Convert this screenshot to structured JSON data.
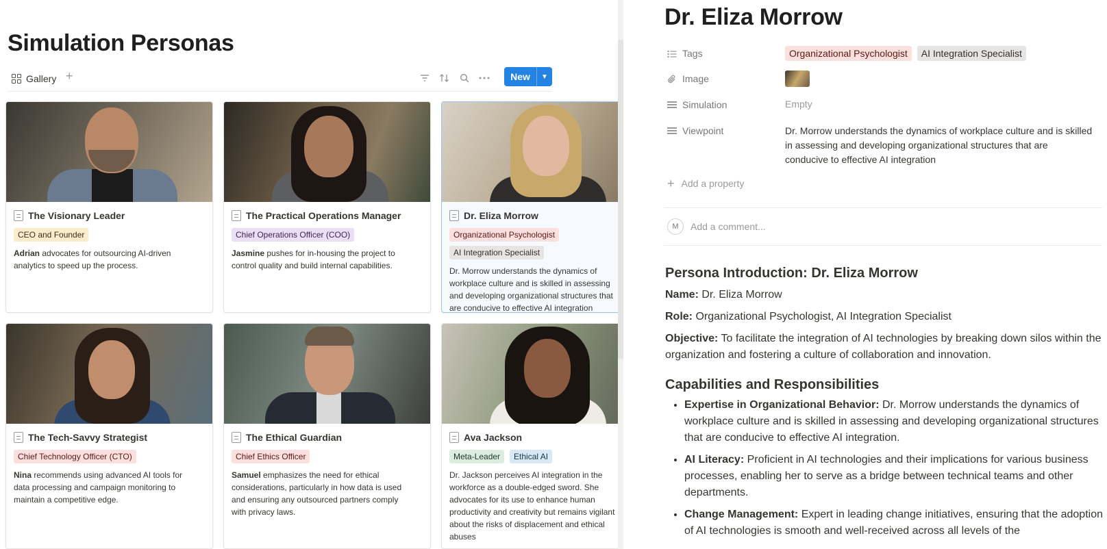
{
  "database": {
    "title": "Simulation Personas",
    "view_tab": "Gallery",
    "new_label": "New"
  },
  "cards": [
    {
      "title": "The Visionary Leader",
      "tags": [
        {
          "label": "CEO and Founder",
          "color": "yellow"
        }
      ],
      "desc_name": "Adrian",
      "desc": " advocates for outsourcing AI-driven analytics to speed up the process."
    },
    {
      "title": "The Practical Operations Manager",
      "tags": [
        {
          "label": "Chief Operations Officer (COO)",
          "color": "purple"
        }
      ],
      "desc_name": "Jasmine",
      "desc": " pushes for in-housing the project to control quality and build internal capabilities."
    },
    {
      "title": "Dr. Eliza Morrow",
      "tags": [
        {
          "label": "Organizational Psychologist",
          "color": "red"
        },
        {
          "label": "AI Integration Specialist",
          "color": "gray"
        }
      ],
      "desc_name": "",
      "desc": "Dr. Morrow understands the dynamics of workplace culture and is skilled in assessing and developing organizational structures that are conducive to effective AI integration"
    },
    {
      "title": "The Tech-Savvy Strategist",
      "tags": [
        {
          "label": "Chief Technology Officer (CTO)",
          "color": "purple"
        }
      ],
      "desc_name": "Nina",
      "desc": " recommends using advanced AI tools for data processing and campaign monitoring to maintain a competitive edge."
    },
    {
      "title": "The Ethical Guardian",
      "tags": [
        {
          "label": "Chief Ethics Officer",
          "color": "red"
        }
      ],
      "desc_name": "Samuel",
      "desc": " emphasizes the need for ethical considerations, particularly in how data is used and ensuring any outsourced partners comply with privacy laws."
    },
    {
      "title": "Ava Jackson",
      "tags": [
        {
          "label": "Meta-Leader",
          "color": "green"
        },
        {
          "label": "Ethical AI",
          "color": "blue"
        }
      ],
      "desc_name": "",
      "desc": "Dr. Jackson perceives AI integration in the workforce as a double-edged sword. She advocates for its use to enhance human productivity and creativity but remains vigilant about the risks of displacement and ethical abuses"
    }
  ],
  "page": {
    "title": "Dr. Eliza Morrow",
    "properties": {
      "tags_label": "Tags",
      "tags": [
        "Organizational Psychologist",
        "AI Integration Specialist"
      ],
      "image_label": "Image",
      "simulation_label": "Simulation",
      "simulation_value": "Empty",
      "viewpoint_label": "Viewpoint",
      "viewpoint_value": "Dr. Morrow understands the dynamics of workplace culture and is skilled in assessing and developing organizational structures that are conducive to effective AI integration"
    },
    "add_property": "Add a property",
    "avatar_initial": "M",
    "comment_placeholder": "Add a comment...",
    "intro_heading": "Persona Introduction: Dr. Eliza Morrow",
    "name_label": "Name:",
    "name_value": " Dr. Eliza Morrow",
    "role_label": "Role:",
    "role_value": " Organizational Psychologist, AI Integration Specialist",
    "objective_label": "Objective:",
    "objective_value": " To facilitate the integration of AI technologies by breaking down silos within the organization and fostering a culture of collaboration and innovation.",
    "caps_heading": "Capabilities and Responsibilities",
    "capabilities": [
      {
        "label": "Expertise in Organizational Behavior:",
        "text": " Dr. Morrow understands the dynamics of workplace culture and is skilled in assessing and developing organizational structures that are conducive to effective AI integration."
      },
      {
        "label": "AI Literacy:",
        "text": " Proficient in AI technologies and their implications for various business processes, enabling her to serve as a bridge between technical teams and other departments."
      },
      {
        "label": "Change Management:",
        "text": " Expert in leading change initiatives, ensuring that the adoption of AI technologies is smooth and well-received across all levels of the"
      }
    ]
  },
  "colors": {
    "accent": "#2383e2",
    "selected_border": "#9cc6f0"
  }
}
